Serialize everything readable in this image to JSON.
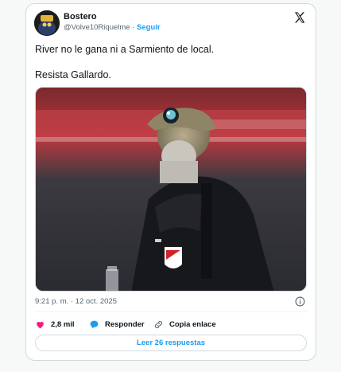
{
  "tweet": {
    "author_name": "Bostero",
    "handle": "@Volve10Riquelme",
    "separator": "·",
    "follow_label": "Seguir",
    "text_line_1": "River no le gana ni a Sarmiento de local.",
    "text_line_2": "Resista Gallardo.",
    "timestamp": "9:21 p. m. · 12 oct. 2025"
  },
  "actions": {
    "likes": "2,8 mil",
    "reply_label": "Responder",
    "copy_link_label": "Copia enlace"
  },
  "read_replies_label": "Leer 26 respuestas",
  "colors": {
    "accent": "#1d9bf0",
    "like": "#f91880",
    "muted": "#536471",
    "border": "#cfd9de"
  },
  "icons": [
    "x-logo-icon",
    "info-icon",
    "heart-icon",
    "reply-bubble-icon",
    "link-icon"
  ]
}
